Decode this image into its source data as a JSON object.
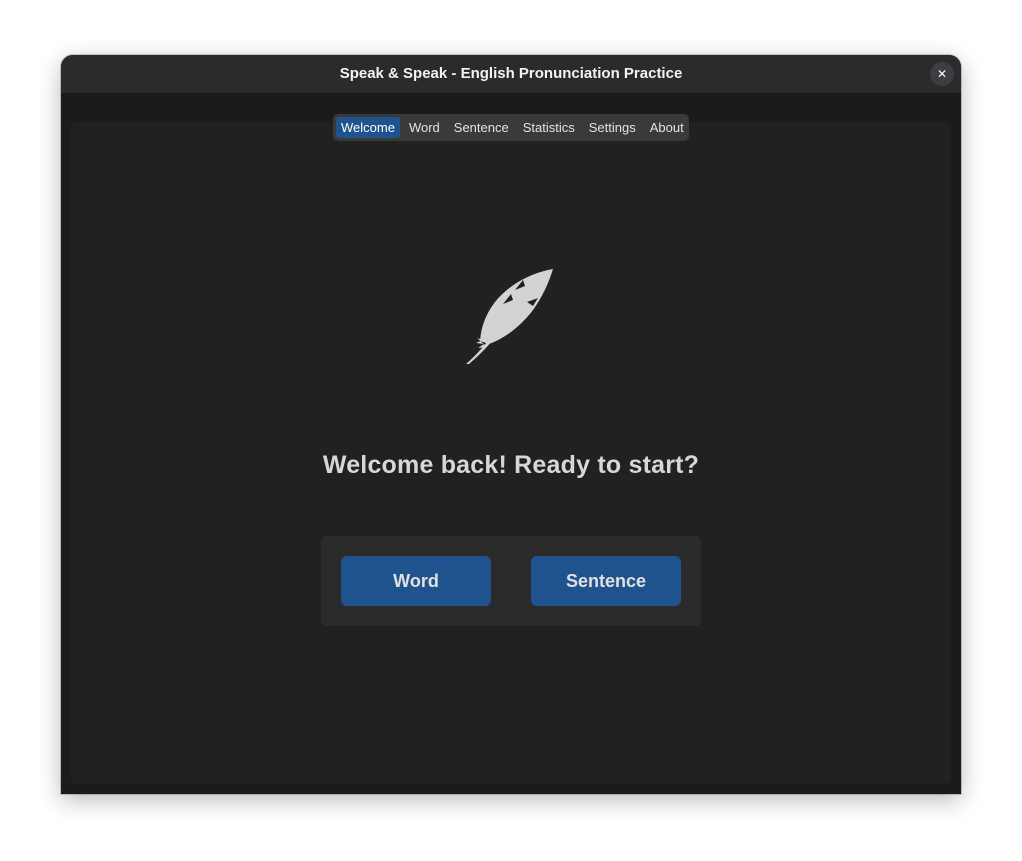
{
  "window": {
    "title": "Speak & Speak - English Pronunciation Practice",
    "close_label": "✕"
  },
  "tabs": [
    {
      "label": "Welcome",
      "active": true
    },
    {
      "label": "Word",
      "active": false
    },
    {
      "label": "Sentence",
      "active": false
    },
    {
      "label": "Statistics",
      "active": false
    },
    {
      "label": "Settings",
      "active": false
    },
    {
      "label": "About",
      "active": false
    }
  ],
  "main": {
    "icon": "feather-icon",
    "welcome_text": "Welcome back! Ready to start?",
    "word_button": "Word",
    "sentence_button": "Sentence"
  },
  "colors": {
    "accent": "#1f538d",
    "background": "#212121",
    "titlebar": "#2b2b2e",
    "text": "#d7d7d7"
  }
}
